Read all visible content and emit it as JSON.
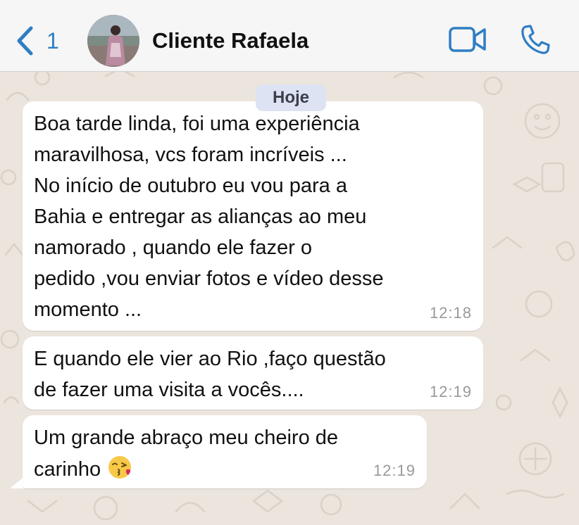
{
  "header": {
    "back_count": "1",
    "contact_name": "Cliente Rafaela",
    "icons": {
      "back": "chevron-left-icon",
      "video": "video-camera-icon",
      "call": "phone-icon"
    },
    "accent_color": "#2e7ec4"
  },
  "chat": {
    "date_label": "Hoje",
    "messages": [
      {
        "text": "Boa tarde linda, foi uma experiência\nmaravilhosa, vcs foram incríveis ...\nNo início de outubro eu vou para a\nBahia e entregar as alianças ao meu\nnamorado , quando ele fazer o\npedido ,vou enviar fotos e vídeo desse\nmomento ...",
        "time": "12:18"
      },
      {
        "text": "E quando ele vier ao Rio ,faço questão\nde fazer uma visita a vocês....",
        "time": "12:19"
      },
      {
        "text": "Um grande abraço meu cheiro de\ncarinho ",
        "emoji": "kissing-heart-emoji",
        "time": "12:19"
      }
    ]
  }
}
